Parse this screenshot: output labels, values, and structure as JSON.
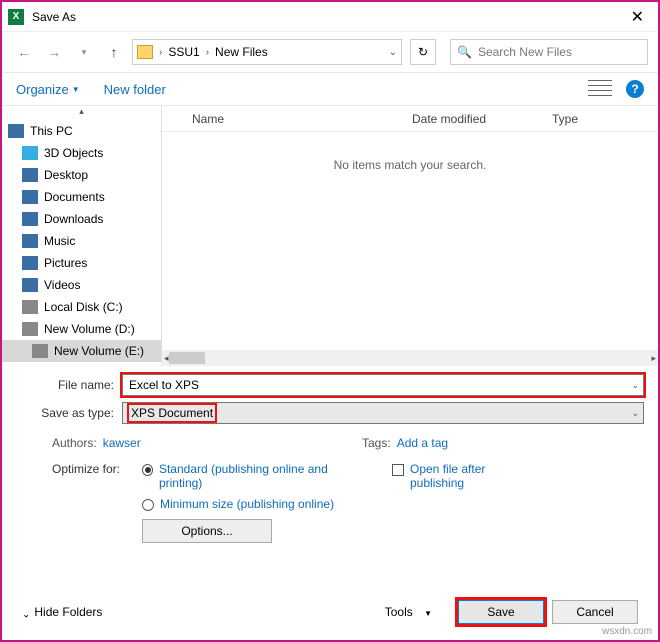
{
  "title": "Save As",
  "breadcrumb": {
    "seg1": "SSU1",
    "seg2": "New Files"
  },
  "search_placeholder": "Search New Files",
  "toolbar": {
    "organize": "Organize",
    "newfolder": "New folder"
  },
  "tree": {
    "this_pc": "This PC",
    "objects_3d": "3D Objects",
    "desktop": "Desktop",
    "documents": "Documents",
    "downloads": "Downloads",
    "music": "Music",
    "pictures": "Pictures",
    "videos": "Videos",
    "local_c": "Local Disk (C:)",
    "vol_d": "New Volume (D:)",
    "vol_e": "New Volume (E:)"
  },
  "columns": {
    "name": "Name",
    "date": "Date modified",
    "type": "Type"
  },
  "empty_text": "No items match your search.",
  "form": {
    "file_name_label": "File name:",
    "file_name_value": "Excel to XPS",
    "save_type_label": "Save as type:",
    "save_type_value": "XPS Document"
  },
  "meta": {
    "authors_label": "Authors:",
    "authors_value": "kawser",
    "tags_label": "Tags:",
    "tags_value": "Add a tag"
  },
  "optimize": {
    "label": "Optimize for:",
    "standard": "Standard (publishing online and printing)",
    "minimum": "Minimum size (publishing online)",
    "openafter": "Open file after publishing"
  },
  "options_btn": "Options...",
  "footer": {
    "hide": "Hide Folders",
    "tools": "Tools",
    "save": "Save",
    "cancel": "Cancel"
  },
  "watermark": "wsxdn.com"
}
